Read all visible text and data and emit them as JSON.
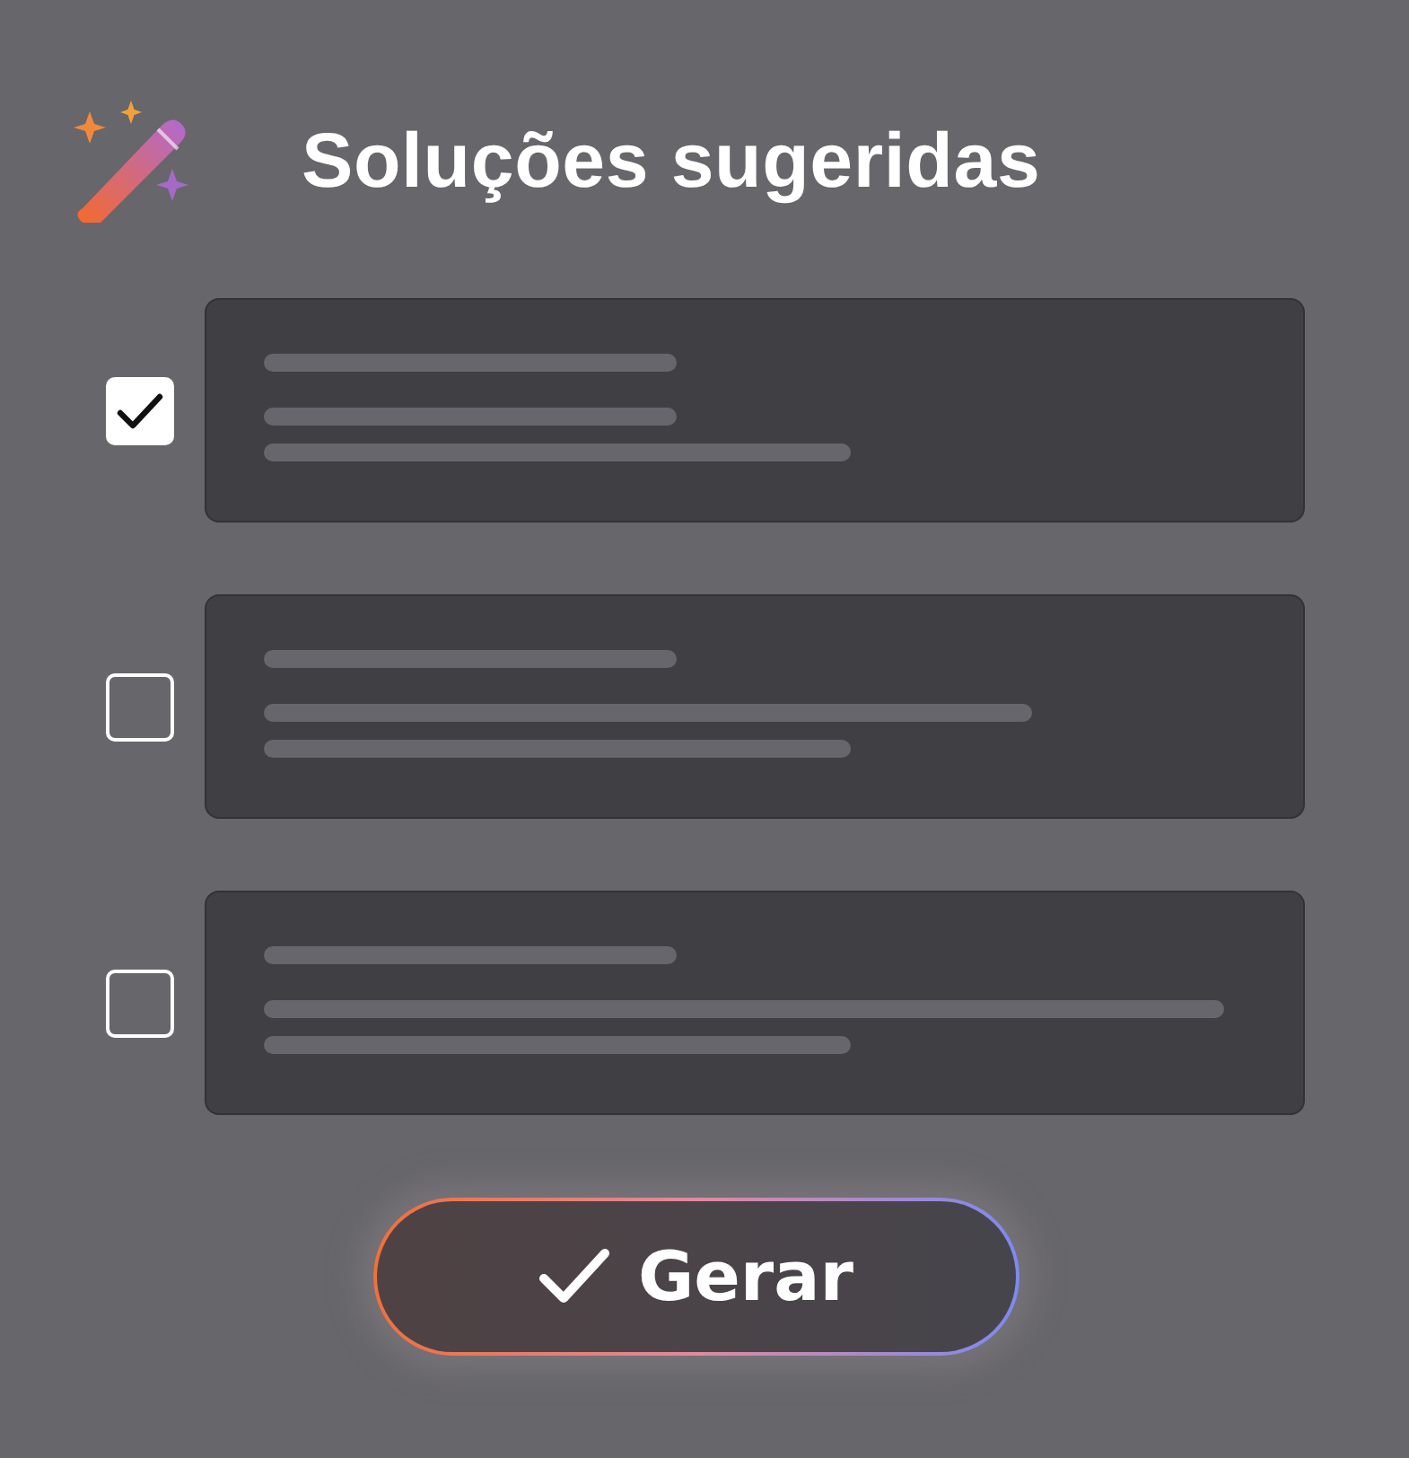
{
  "title": "Soluções sugeridas",
  "suggestions": [
    {
      "checked": true
    },
    {
      "checked": false
    },
    {
      "checked": false
    }
  ],
  "button": {
    "label": "Gerar"
  }
}
